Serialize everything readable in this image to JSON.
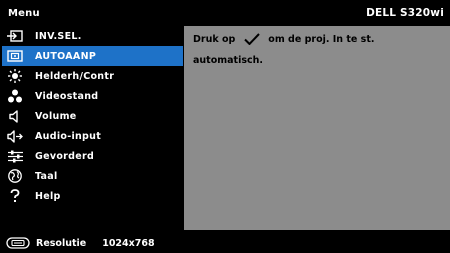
{
  "header": {
    "title": "Menu",
    "model": "DELL S320wi"
  },
  "menu": {
    "items": [
      {
        "label": "INV.SEL.",
        "icon": "input-icon",
        "selected": false
      },
      {
        "label": "AUTOAANP",
        "icon": "auto-adjust-icon",
        "selected": true
      },
      {
        "label": "Helderh/Contr",
        "icon": "brightness-icon",
        "selected": false
      },
      {
        "label": "Videostand",
        "icon": "video-mode-icon",
        "selected": false
      },
      {
        "label": "Volume",
        "icon": "volume-icon",
        "selected": false
      },
      {
        "label": "Audio-input",
        "icon": "audio-input-icon",
        "selected": false
      },
      {
        "label": "Gevorderd",
        "icon": "advanced-settings-icon",
        "selected": false
      },
      {
        "label": "Taal",
        "icon": "language-icon",
        "selected": false
      },
      {
        "label": "Help",
        "icon": "help-icon",
        "selected": false
      }
    ]
  },
  "panel": {
    "text_before_check": "Druk op",
    "check_icon": "checkmark-icon",
    "text_after_check": "om de proj. In te st.",
    "line2": "automatisch."
  },
  "footer": {
    "resolution_label": "Resolutie",
    "resolution_value": "1024x768",
    "icon": "resolution-icon"
  },
  "colors": {
    "background": "#000000",
    "selected": "#1e72c8",
    "panel": "#8c8c8c"
  }
}
